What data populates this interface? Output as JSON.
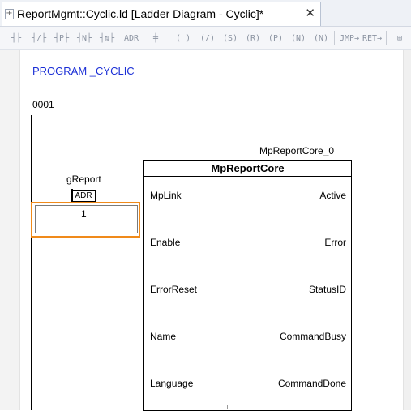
{
  "tab": {
    "title": "ReportMgmt::Cyclic.ld [Ladder Diagram - Cyclic]*",
    "close_glyph": "✕"
  },
  "toolbar": {
    "buttons": [
      {
        "name": "contact-no-icon",
        "glyph": "┤├"
      },
      {
        "name": "contact-nc-icon",
        "glyph": "┤/├"
      },
      {
        "name": "contact-p-icon",
        "glyph": "┤P├"
      },
      {
        "name": "contact-n-icon",
        "glyph": "┤N├"
      },
      {
        "name": "contact-pn-icon",
        "glyph": "┤⇅├"
      },
      {
        "name": "adr-icon",
        "glyph": "ADR"
      },
      {
        "name": "function-block-icon",
        "glyph": "╪"
      },
      {
        "name": "coil-icon",
        "glyph": "( )"
      },
      {
        "name": "coil-negated-icon",
        "glyph": "(/)"
      },
      {
        "name": "coil-set-icon",
        "glyph": "(S)"
      },
      {
        "name": "coil-reset-icon",
        "glyph": "(R)"
      },
      {
        "name": "coil-positive-icon",
        "glyph": "(P)"
      },
      {
        "name": "coil-negative-icon",
        "glyph": "(N)"
      },
      {
        "name": "coil-n2-icon",
        "glyph": "(N)"
      },
      {
        "name": "jump-icon",
        "glyph": "JMP→"
      },
      {
        "name": "return-icon",
        "glyph": "RET→"
      },
      {
        "name": "add-network-icon",
        "glyph": "⊞"
      }
    ]
  },
  "editor": {
    "program_title": "PROGRAM _CYCLIC",
    "rung_number": "0001",
    "instance_name": "MpReportCore_0",
    "function_block": {
      "type_name": "MpReportCore",
      "inputs": [
        "MpLink",
        "Enable",
        "ErrorReset",
        "Name",
        "Language"
      ],
      "outputs": [
        "Active",
        "Error",
        "StatusID",
        "CommandBusy",
        "CommandDone"
      ]
    },
    "variable": {
      "name": "gReport",
      "operator": "ADR"
    },
    "inline_edit": {
      "value": "1"
    }
  },
  "colors": {
    "program_title": "#1b2fd6",
    "focus_border": "#f08a1a"
  }
}
